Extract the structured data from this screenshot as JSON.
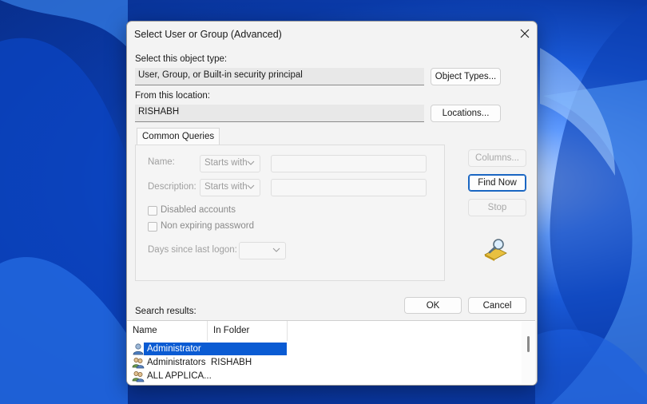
{
  "dialog": {
    "title": "Select User or Group (Advanced)",
    "object_type_label": "Select this object type:",
    "object_type_value": "User, Group, or Built-in security principal",
    "object_types_button": "Object Types...",
    "location_label": "From this location:",
    "location_value": "RISHABH",
    "locations_button": "Locations...",
    "tab_label": "Common Queries",
    "name_label": "Name:",
    "name_mode": "Starts with",
    "description_label": "Description:",
    "description_mode": "Starts with",
    "disabled_accounts_label": "Disabled accounts",
    "non_expiring_label": "Non expiring password",
    "days_logon_label": "Days since last logon:",
    "columns_button": "Columns...",
    "find_now_button": "Find Now",
    "stop_button": "Stop",
    "ok_button": "OK",
    "cancel_button": "Cancel",
    "search_results_label": "Search results:"
  },
  "results": {
    "columns": [
      "Name",
      "In Folder"
    ],
    "rows": [
      {
        "name": "Administrator",
        "folder": "",
        "selected": true,
        "icon": "user-icon"
      },
      {
        "name": "Administrators",
        "folder": "RISHABH",
        "selected": false,
        "icon": "group-icon"
      },
      {
        "name": "ALL APPLICA...",
        "folder": "",
        "selected": false,
        "icon": "group-icon"
      }
    ]
  },
  "colors": {
    "selection": "#0a5bd3",
    "default_button_border": "#1a66c2",
    "wallpaper": "#1a5ad8"
  }
}
